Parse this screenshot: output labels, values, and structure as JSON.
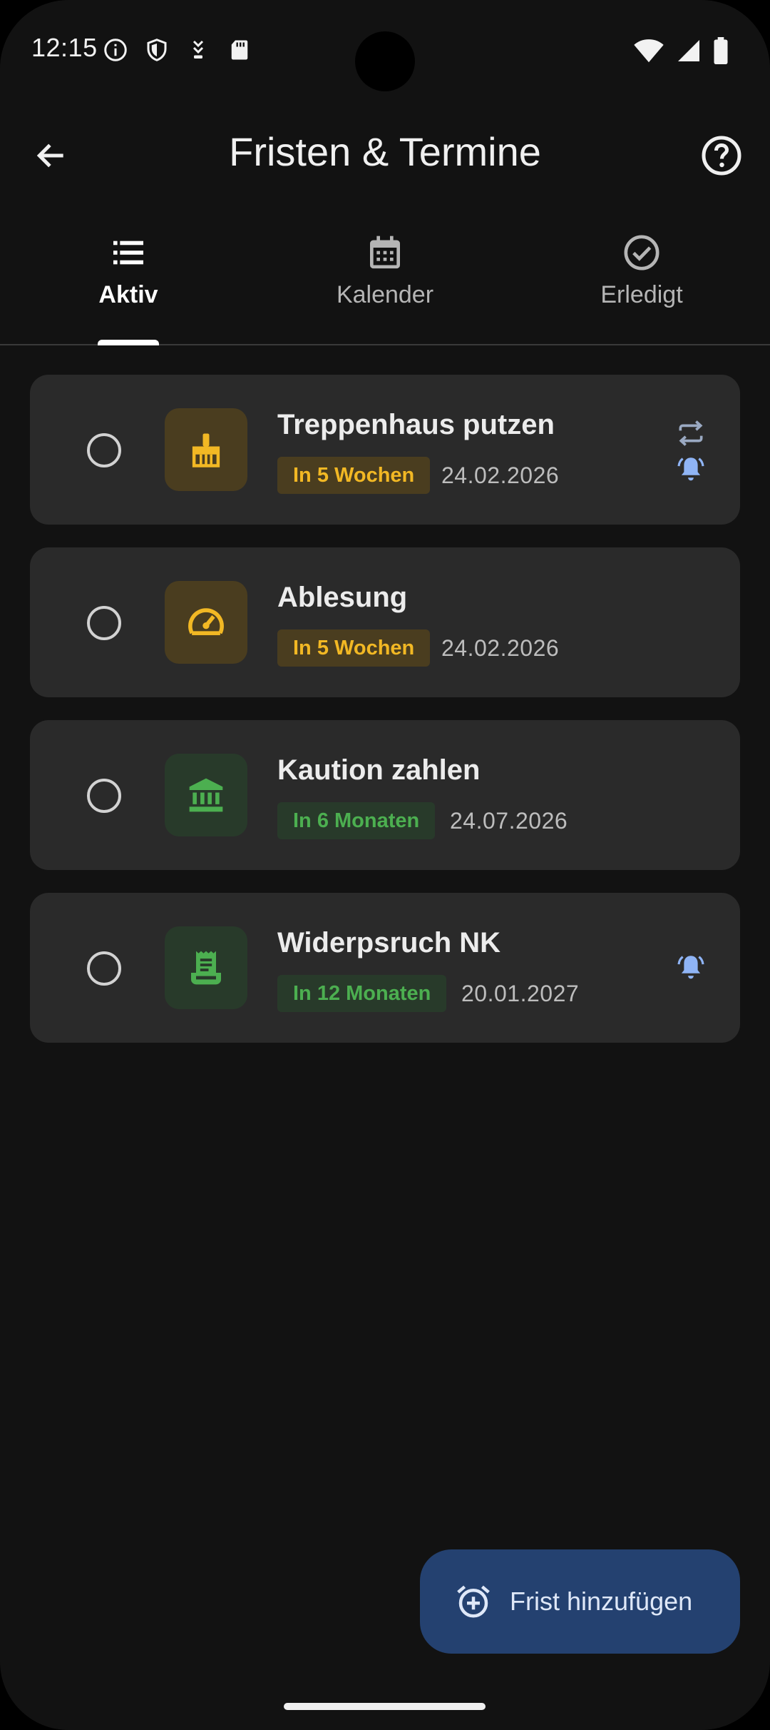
{
  "status_bar": {
    "time": "12:15",
    "left_icons": [
      "info-icon",
      "shield-icon",
      "download-arrows-icon",
      "sd-card-icon"
    ],
    "right_icons": [
      "wifi-icon",
      "signal-icon",
      "battery-icon"
    ]
  },
  "app_bar": {
    "title": "Fristen & Termine",
    "back_icon": "arrow-back-icon",
    "help_icon": "help-circle-icon"
  },
  "tabs": [
    {
      "label": "Aktiv",
      "icon": "list-icon",
      "active": true
    },
    {
      "label": "Kalender",
      "icon": "calendar-icon",
      "active": false
    },
    {
      "label": "Erledigt",
      "icon": "check-circle-icon",
      "active": false
    }
  ],
  "tasks": [
    {
      "title": "Treppenhaus putzen",
      "badge": "In 5 Wochen",
      "date": "24.02.2026",
      "icon": "broom-icon",
      "tone": "amber",
      "repeat": true,
      "reminder": true
    },
    {
      "title": "Ablesung",
      "badge": "In 5 Wochen",
      "date": "24.02.2026",
      "icon": "gauge-icon",
      "tone": "amber",
      "repeat": false,
      "reminder": false
    },
    {
      "title": "Kaution zahlen",
      "badge": "In 6 Monaten",
      "date": "24.07.2026",
      "icon": "bank-icon",
      "tone": "green",
      "repeat": false,
      "reminder": false
    },
    {
      "title": "Widerpsruch NK",
      "badge": "In 12 Monaten",
      "date": "20.01.2027",
      "icon": "receipt-icon",
      "tone": "green",
      "repeat": false,
      "reminder": true
    }
  ],
  "fab": {
    "label": "Frist hinzufügen",
    "icon": "alarm-add-icon"
  },
  "colors": {
    "background": "#121212",
    "card": "#2a2a2a",
    "amber_accent": "#f2b824",
    "amber_bg": "#4a3d1f",
    "green_accent": "#4caf50",
    "green_bg": "#283a2a",
    "bell_blue": "#8fb4f5",
    "fab_bg": "#244170"
  }
}
